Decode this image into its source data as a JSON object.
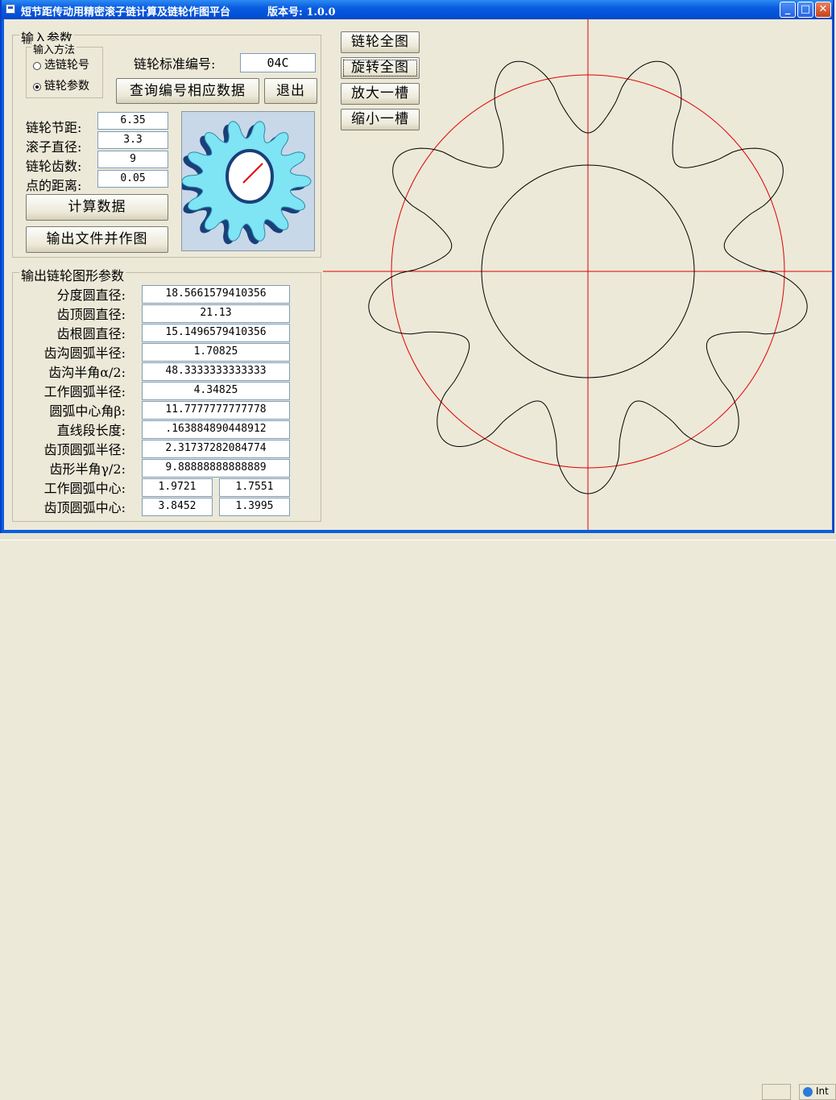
{
  "window": {
    "title": "短节距传动用精密滚子链计算及链轮作图平台",
    "version": "版本号: 1.0.0",
    "minimize_label": "_",
    "maximize_label": "□",
    "close_label": "✕"
  },
  "input": {
    "group_label": "输入参数",
    "method_label": "输入方法",
    "option_select": "选链轮号",
    "option_params": "链轮参数",
    "selected_option": "链轮参数",
    "standard_no_label": "链轮标准编号:",
    "standard_no_value": "04C",
    "query_button": "查询编号相应数据",
    "exit_button": "退出",
    "fields": [
      {
        "label": "链轮节距:",
        "value": "6.35"
      },
      {
        "label": "滚子直径:",
        "value": "3.3"
      },
      {
        "label": "链轮齿数:",
        "value": "9"
      },
      {
        "label": "点的距离:",
        "value": "0.05"
      }
    ],
    "calc_button": "计算数据",
    "output_button": "输出文件并作图"
  },
  "output": {
    "group_label": "输出链轮图形参数",
    "rows": [
      {
        "label": "分度圆直径:",
        "value": "18.5661579410356"
      },
      {
        "label": "齿顶圆直径:",
        "value": "21.13"
      },
      {
        "label": "齿根圆直径:",
        "value": "15.1496579410356"
      },
      {
        "label": "齿沟圆弧半径:",
        "value": "1.70825"
      },
      {
        "label": "齿沟半角α/2:",
        "value": "48.3333333333333"
      },
      {
        "label": "工作圆弧半径:",
        "value": "4.34825"
      },
      {
        "label": "圆弧中心角β:",
        "value": "11.7777777777778"
      },
      {
        "label": "直线段长度:",
        "value": ".163884890448912"
      },
      {
        "label": "齿顶圆弧半径:",
        "value": "2.31737282084774"
      },
      {
        "label": "齿形半角γ/2:",
        "value": "9.88888888888889"
      }
    ],
    "center_rows": [
      {
        "label": "工作圆弧中心:",
        "x": "1.9721",
        "y": "1.7551"
      },
      {
        "label": "齿顶圆弧中心:",
        "x": "3.8452",
        "y": "1.3995"
      }
    ]
  },
  "view_buttons": [
    "链轮全图",
    "旋转全图",
    "放大一槽",
    "缩小一槽"
  ],
  "drawing": {
    "teeth": 9,
    "pitch_circle_color": "#e00000",
    "profile_color": "#000000",
    "axis_color": "#e00000"
  },
  "taskbar": {
    "tray_text": "Int"
  }
}
